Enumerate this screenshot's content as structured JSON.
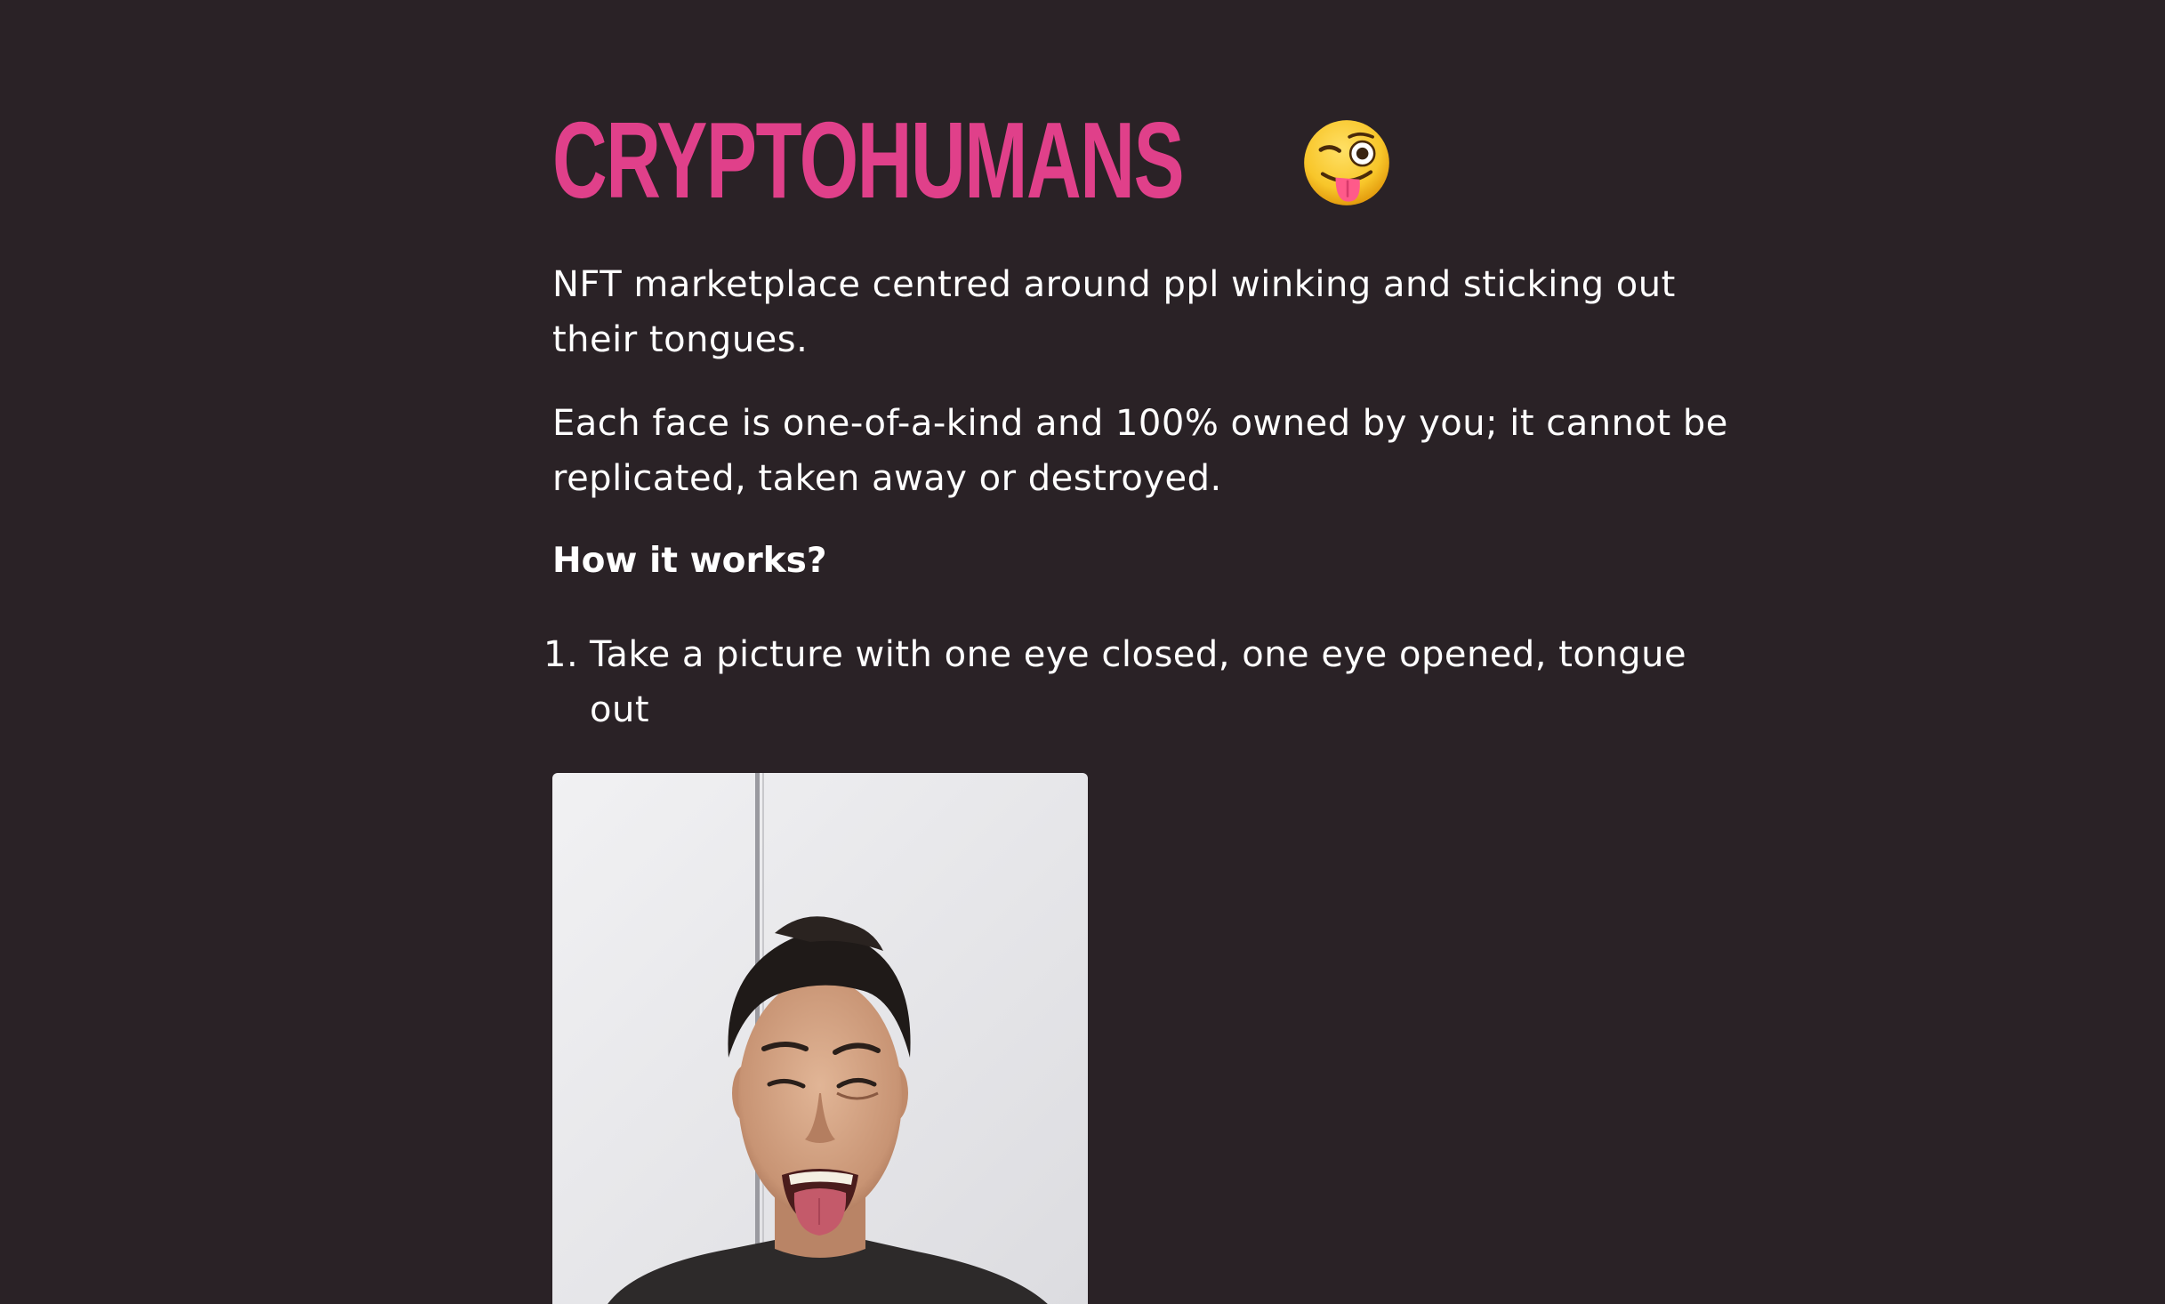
{
  "header": {
    "title": "CRYPTOHUMANS",
    "emoji_icon": "winking-face-with-tongue-icon",
    "title_color": "#e0408a"
  },
  "intro": {
    "paragraph_1": "NFT marketplace centred around ppl winking and sticking out their tongues.",
    "paragraph_2": "Each face is one-of-a-kind and 100% owned by you; it cannot be replicated, taken away or destroyed."
  },
  "how_it_works": {
    "heading": "How it works?",
    "steps": [
      {
        "number": "1.",
        "text": "Take a picture with one eye closed, one eye opened, tongue out"
      }
    ]
  },
  "photo": {
    "subject": "person-winking-with-tongue-out"
  },
  "colors": {
    "background": "#2a2226",
    "accent": "#e0408a",
    "text": "#ffffff"
  }
}
